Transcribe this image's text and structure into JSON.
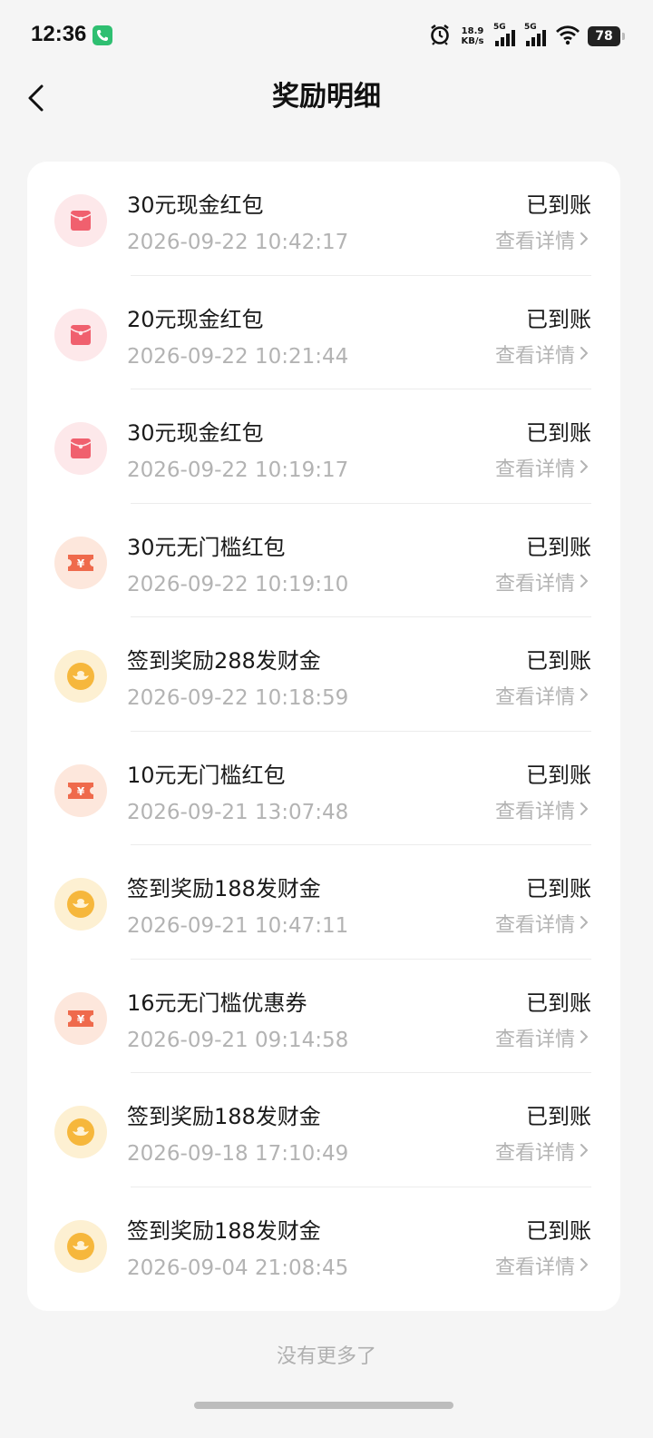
{
  "status_bar": {
    "time": "12:36",
    "net_speed_value": "18.9",
    "net_speed_unit": "KB/s",
    "sim1_label": "5G",
    "sim2_label": "5G",
    "battery": "78",
    "icons": [
      "phone-call-icon",
      "alarm-icon",
      "signal-icon",
      "wifi-icon",
      "battery-icon"
    ]
  },
  "nav": {
    "title": "奖励明细",
    "back_icon": "chevron-left-icon"
  },
  "list": {
    "status_label": "已到账",
    "detail_label": "查看详情",
    "items": [
      {
        "title": "30元现金红包",
        "time": "2026-09-22 10:42:17",
        "icon": "red-envelope-icon"
      },
      {
        "title": "20元现金红包",
        "time": "2026-09-22 10:21:44",
        "icon": "red-envelope-icon"
      },
      {
        "title": "30元现金红包",
        "time": "2026-09-22 10:19:17",
        "icon": "red-envelope-icon"
      },
      {
        "title": "30元无门槛红包",
        "time": "2026-09-22 10:19:10",
        "icon": "coupon-icon"
      },
      {
        "title": "签到奖励288发财金",
        "time": "2026-09-22 10:18:59",
        "icon": "gold-ingot-icon"
      },
      {
        "title": "10元无门槛红包",
        "time": "2026-09-21 13:07:48",
        "icon": "coupon-icon"
      },
      {
        "title": "签到奖励188发财金",
        "time": "2026-09-21 10:47:11",
        "icon": "gold-ingot-icon"
      },
      {
        "title": "16元无门槛优惠券",
        "time": "2026-09-21 09:14:58",
        "icon": "coupon-icon"
      },
      {
        "title": "签到奖励188发财金",
        "time": "2026-09-18 17:10:49",
        "icon": "gold-ingot-icon"
      },
      {
        "title": "签到奖励188发财金",
        "time": "2026-09-04 21:08:45",
        "icon": "gold-ingot-icon"
      }
    ]
  },
  "footer": {
    "no_more": "没有更多了"
  },
  "colors": {
    "envelope_bg": "#fde8ea",
    "envelope": "#f0606e",
    "coupon_bg": "#fde7dc",
    "coupon": "#ef6a4c",
    "ingot_bg": "#fdf0d2",
    "ingot": "#f6b73c"
  }
}
